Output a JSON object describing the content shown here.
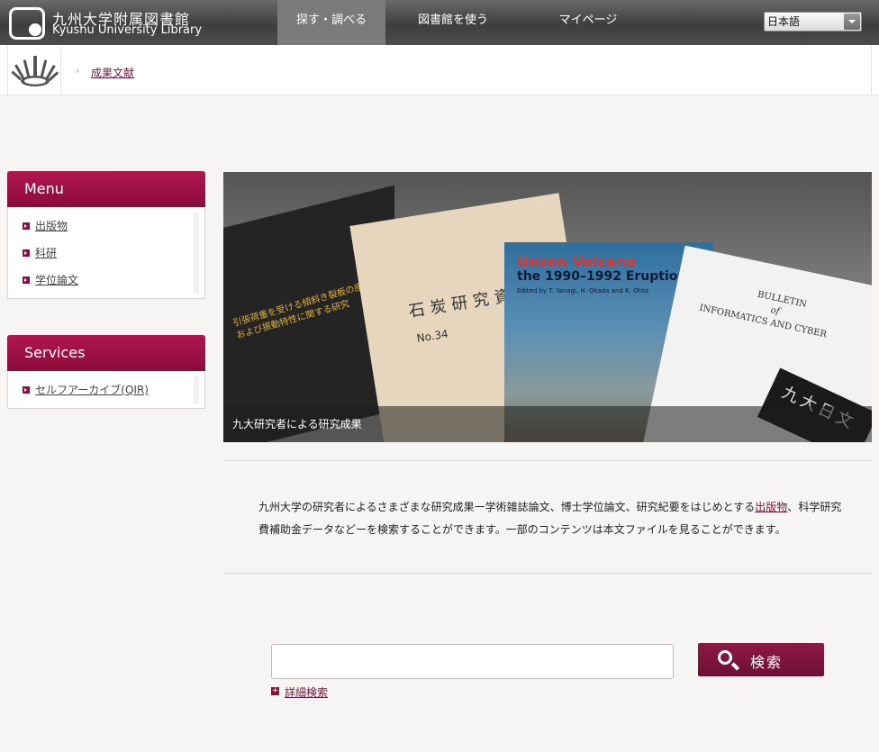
{
  "header": {
    "logo_jp": "九州大学附属図書館",
    "logo_en": "Kyushu University Library",
    "nav": [
      {
        "label": "探す・調べる"
      },
      {
        "label": "図書館を使う"
      },
      {
        "label": "マイページ"
      }
    ],
    "language": "日本語"
  },
  "breadcrumb": {
    "current": "成果文献"
  },
  "menu": {
    "title": "Menu",
    "items": [
      {
        "label": "出版物"
      },
      {
        "label": "科研"
      },
      {
        "label": "学位論文"
      }
    ]
  },
  "services": {
    "title": "Services",
    "items": [
      {
        "label": "セルフアーカイブ(QIR)"
      }
    ]
  },
  "hero": {
    "caption": "九大研究者による研究成果",
    "book_black": "引張荷重を受ける傾斜き裂板の座屈",
    "book_black_2": "および振動特性に関する研究",
    "book_tan_title": "石炭研究資料",
    "book_tan_no": "No.34",
    "volcano_title": "Unzen Volcano",
    "volcano_sub": "the 1990–1992 Eruption",
    "volcano_auth": "Edited by T. Yanagi, H. Okada and K. Ohta",
    "bulletin_title": "BULLETIN",
    "bulletin_of": "of",
    "bulletin_sub": "INFORMATICS AND CYBER",
    "kyudai": "九大日文"
  },
  "description": {
    "before": "九州大学の研究者によるさまざまな研究成果ー学術雑誌論文、博士学位論文、研究紀要をはじめとする",
    "link": "出版物",
    "after": "、科学研究費補助金データなどーを検索することができます。一部のコンテンツは本文ファイルを見ることができます。"
  },
  "search": {
    "placeholder": "",
    "button_label": "検索",
    "advanced_label": "詳細検索"
  }
}
